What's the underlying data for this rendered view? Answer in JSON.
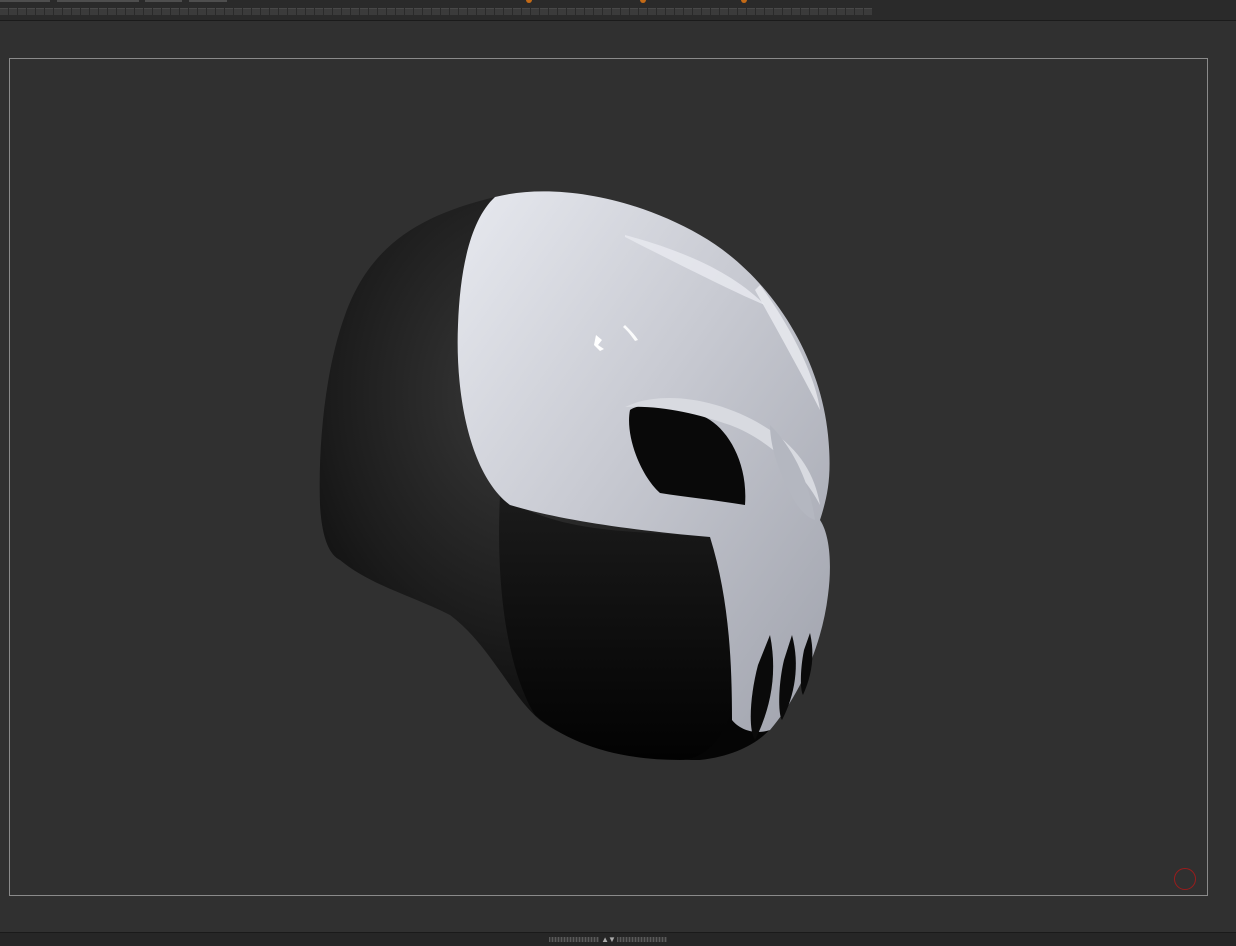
{
  "toolbar": {
    "tabs": [
      "",
      "",
      "",
      ""
    ],
    "accent_color": "#c46a16"
  },
  "viewport": {
    "model": {
      "name": "mask-icon",
      "shell_color": "#1a1a1a",
      "face_color": "#c9cbd2"
    },
    "background_color": "#303030",
    "frame_color": "#8a8a8a",
    "indicator_color": "#9b1c1c"
  },
  "bottom_bar": {
    "splitter_arrows": "▲▼"
  }
}
